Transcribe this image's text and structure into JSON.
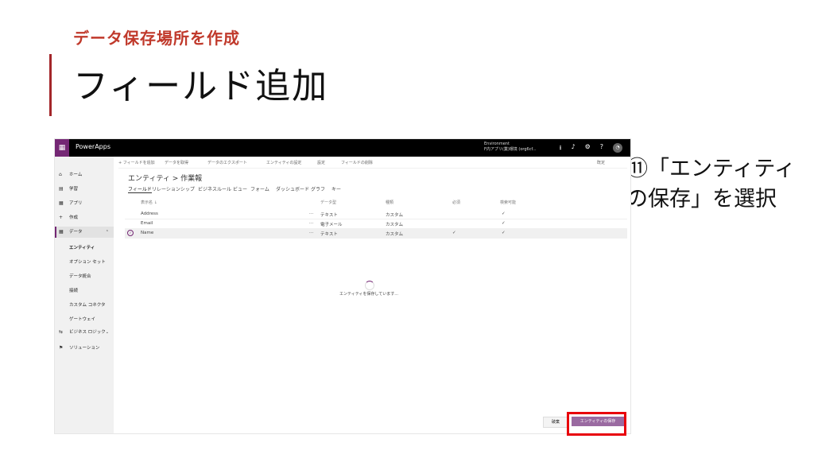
{
  "slide": {
    "subtitle": "データ保存場所を作成",
    "title": "フィールド追加",
    "annotation": "⑪「エンティティの保存」を選択"
  },
  "app": {
    "name": "PowerApps",
    "environment_line1": "Environment",
    "environment_line2": "F内アプリ(業)環境 (org6cf..."
  },
  "topbar_icons": [
    "download-icon",
    "bell-icon",
    "gear-icon",
    "help-icon",
    "avatar"
  ],
  "sidebar": {
    "items": [
      {
        "icon": "⌂",
        "label": "ホーム"
      },
      {
        "icon": "▤",
        "label": "学習"
      },
      {
        "icon": "▦",
        "label": "アプリ"
      },
      {
        "icon": "+",
        "label": "作成"
      },
      {
        "icon": "▦",
        "label": "データ",
        "chevron": "⌃"
      },
      {
        "icon": "⇆",
        "label": "ビジネス ロジック",
        "chevron": "⌄"
      },
      {
        "icon": "⚑",
        "label": "ソリューション"
      }
    ],
    "sub_items": [
      "エンティティ",
      "オプション セット",
      "データ統合",
      "接続",
      "カスタム コネクタ",
      "ゲートウェイ"
    ]
  },
  "commands": [
    "+ フィールドを追加",
    "データを取得",
    "データのエクスポート",
    "エンティティの設定",
    "設定",
    "フィールドの削除"
  ],
  "view_label": "既定",
  "breadcrumb": "エンティティ > 作業報",
  "tabs": [
    "フィールド",
    "リレーションシップ",
    "ビジネスルール",
    "ビュー",
    "フォーム",
    "ダッシュボード",
    "グラフ",
    "キー"
  ],
  "table": {
    "headers": [
      "表示名 ↓",
      "データ型",
      "種類",
      "必須",
      "検索可能"
    ],
    "rows": [
      {
        "name": "Address",
        "type": "テキスト",
        "kind": "カスタム",
        "required": "",
        "searchable": "✓"
      },
      {
        "name": "Email",
        "type": "電子メール",
        "kind": "カスタム",
        "required": "",
        "searchable": "✓"
      },
      {
        "name": "Name",
        "type": "テキスト",
        "kind": "カスタム",
        "required": "✓",
        "searchable": "✓"
      }
    ]
  },
  "saving_text": "エンティティを保存しています...",
  "buttons": {
    "discard": "破棄",
    "save": "エンティティの保存"
  },
  "colors": {
    "accent": "#742774",
    "highlight": "#e8000b",
    "title_red": "#c0392b"
  }
}
